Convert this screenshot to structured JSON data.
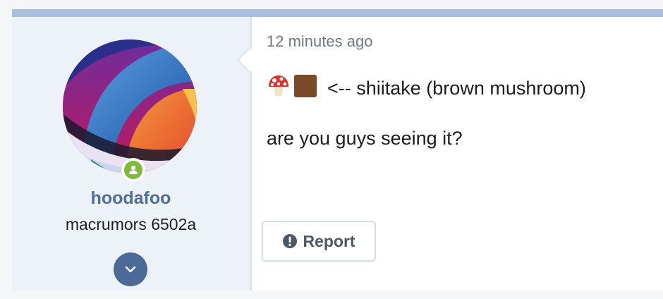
{
  "post": {
    "author": {
      "username": "hoodafoo",
      "user_title": "macrumors 6502a",
      "avatar": "colorful-abstract-wallpaper-avatar",
      "status": "online"
    },
    "timestamp": "12 minutes ago",
    "body": {
      "line1_emoji": [
        "mushroom-emoji",
        "brown-square-emoji"
      ],
      "line1_text": "<-- shiitake (brown mushroom)",
      "line2_text": "are you guys seeing it?"
    },
    "actions": {
      "report_label": "Report",
      "expand_icon": "chevron-down-icon",
      "report_icon": "exclamation-circle-icon"
    }
  },
  "colors": {
    "accent_bar": "#a8bfe0",
    "username": "#4f6e99",
    "online": "#7fba3d",
    "expand_button": "#4c6a98"
  }
}
